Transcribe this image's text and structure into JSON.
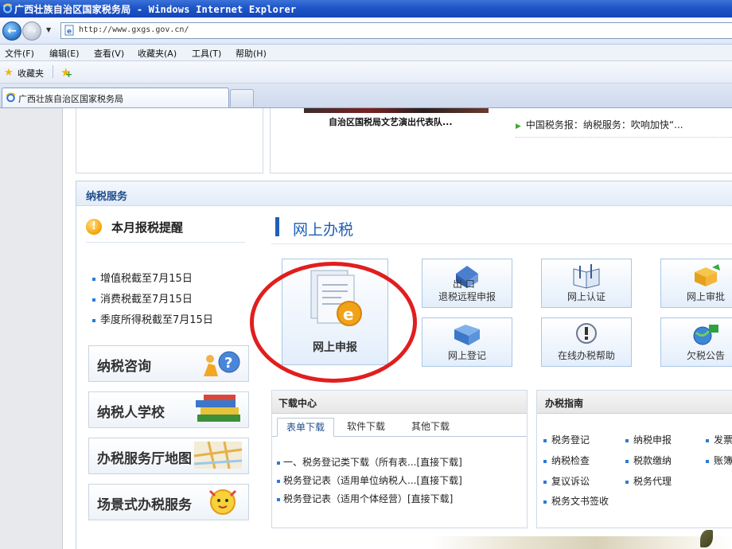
{
  "window": {
    "title": "广西壮族自治区国家税务局 - Windows Internet Explorer"
  },
  "address": {
    "url": "http://www.gxgs.gov.cn/"
  },
  "menu": {
    "items": [
      "文件(F)",
      "编辑(E)",
      "查看(V)",
      "收藏夹(A)",
      "工具(T)",
      "帮助(H)"
    ]
  },
  "favorites": {
    "label": "收藏夹"
  },
  "tabs": {
    "active": "广西壮族自治区国家税务局"
  },
  "top": {
    "photo_caption": "自治区国税局文艺演出代表队...",
    "news_item": "中国税务报：纳税服务：吹响加快“..."
  },
  "service": {
    "title": "纳税服务",
    "reminder_title": "本月报税提醒",
    "reminders": [
      "增值税截至7月15日",
      "消费税截至7月15日",
      "季度所得税截至7月15日"
    ],
    "side_buttons": [
      "纳税咨询",
      "纳税人学校",
      "办税服务厅地图",
      "场景式办税服务"
    ],
    "online_title": "网上办税",
    "big_tile": "网上申报",
    "tiles": [
      "退税远程申报",
      "网上认证",
      "网上审批",
      "网上登记",
      "在线办税帮助",
      "欠税公告"
    ],
    "tile_overlay": "出 口"
  },
  "download": {
    "title": "下载中心",
    "tabs": [
      "表单下载",
      "软件下载",
      "其他下载"
    ],
    "items": [
      "一、税务登记类下载（所有表...[直接下载]",
      "税务登记表（适用单位纳税人...[直接下载]",
      "税务登记表（适用个体经营）[直接下载]"
    ]
  },
  "guide": {
    "title": "办税指南",
    "items": [
      "税务登记",
      "纳税申报",
      "发票",
      "纳税检查",
      "税款缴纳",
      "账簿",
      "复议诉讼",
      "税务代理",
      "税务文书签收"
    ]
  }
}
